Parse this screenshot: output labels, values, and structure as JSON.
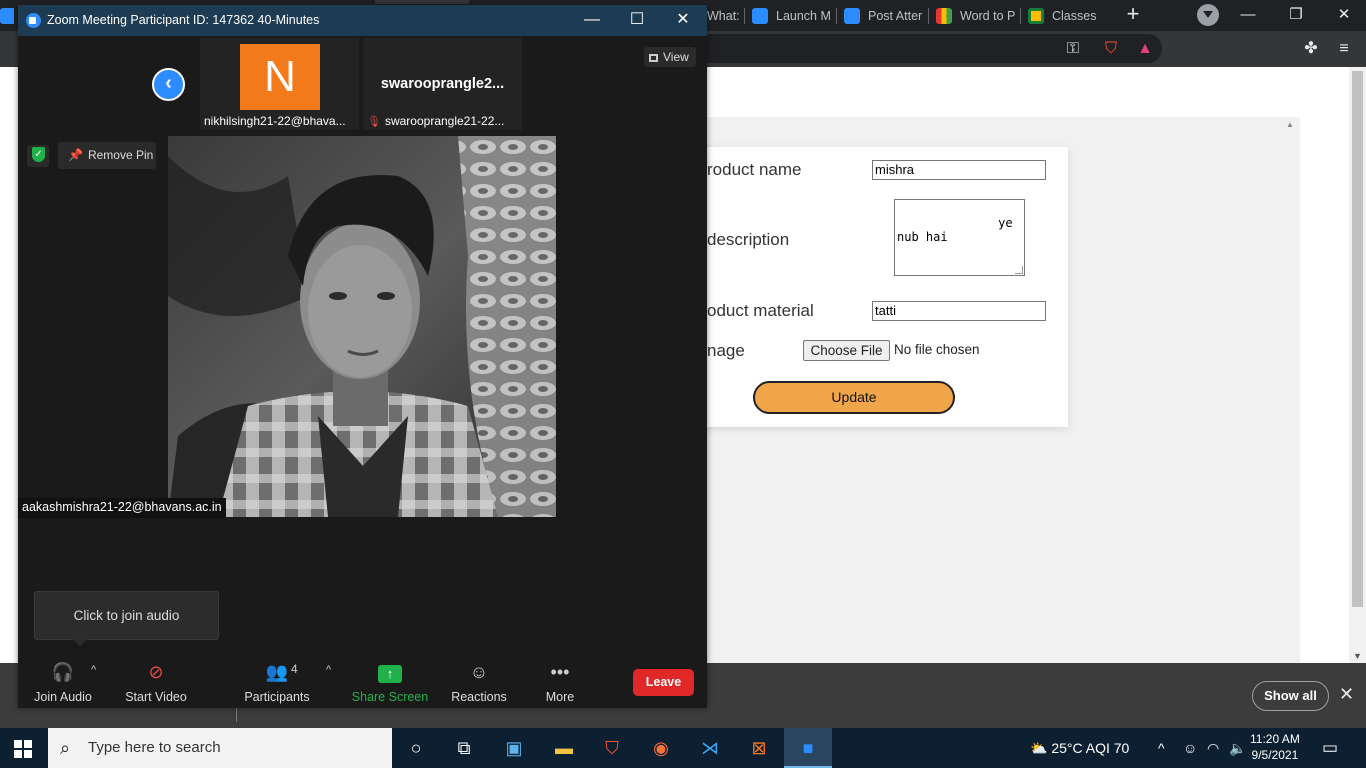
{
  "browser": {
    "tabs": [
      {
        "label": "What:",
        "icon": "whatsapp-icon",
        "color": "#25d366"
      },
      {
        "label": "Launch M",
        "icon": "zoom-icon",
        "color": "#2d8cff"
      },
      {
        "label": "Post Atter",
        "icon": "zoom-icon",
        "color": "#2d8cff"
      },
      {
        "label": "Word to P",
        "icon": "ilovepdf-icon",
        "color": "#e53935"
      },
      {
        "label": "Classes",
        "icon": "google-classroom-icon",
        "color": "#fbbc04"
      }
    ],
    "new_tab_label": "+"
  },
  "form": {
    "product_name_label": "roduct name",
    "product_name_value": "mishra",
    "description_label": "description",
    "description_value": "            ye\nnub hai",
    "material_label": "oduct material",
    "material_value": "tatti",
    "image_label": "nage",
    "choose_file_label": "Choose File",
    "no_file_label": "No file chosen",
    "update_label": "Update",
    "update_color": "#f0a648"
  },
  "notification_bar": {
    "show_all_label": "Show all",
    "close_label": "✕"
  },
  "zoom": {
    "title": "Zoom Meeting Participant ID: 147362   40-Minutes",
    "minimize": "—",
    "maximize": "☐",
    "close": "✕",
    "view_label": "View",
    "remove_pin_label": "Remove Pin",
    "thumbnails": [
      {
        "initial": "N",
        "label": "nikhilsingh21-22@bhava...",
        "avatar_color": "#f27a1a"
      },
      {
        "display_name": "swarooprangle2...",
        "label": "swarooprangle21-22..."
      }
    ],
    "pinned_video_label": "aakashmishra21-22@bhavans.ac.in",
    "tooltip": "Click to join audio",
    "toolbar": {
      "join_audio": "Join Audio",
      "start_video": "Start Video",
      "participants": "Participants",
      "participants_count": "4",
      "share_screen": "Share Screen",
      "reactions": "Reactions",
      "more": "More",
      "leave": "Leave"
    },
    "share_color": "#21b14b",
    "leave_color": "#e02828"
  },
  "taskbar": {
    "search_placeholder": "Type here to search",
    "weather": "25°C  AQI 70",
    "time": "11:20 AM",
    "date": "9/5/2021"
  }
}
